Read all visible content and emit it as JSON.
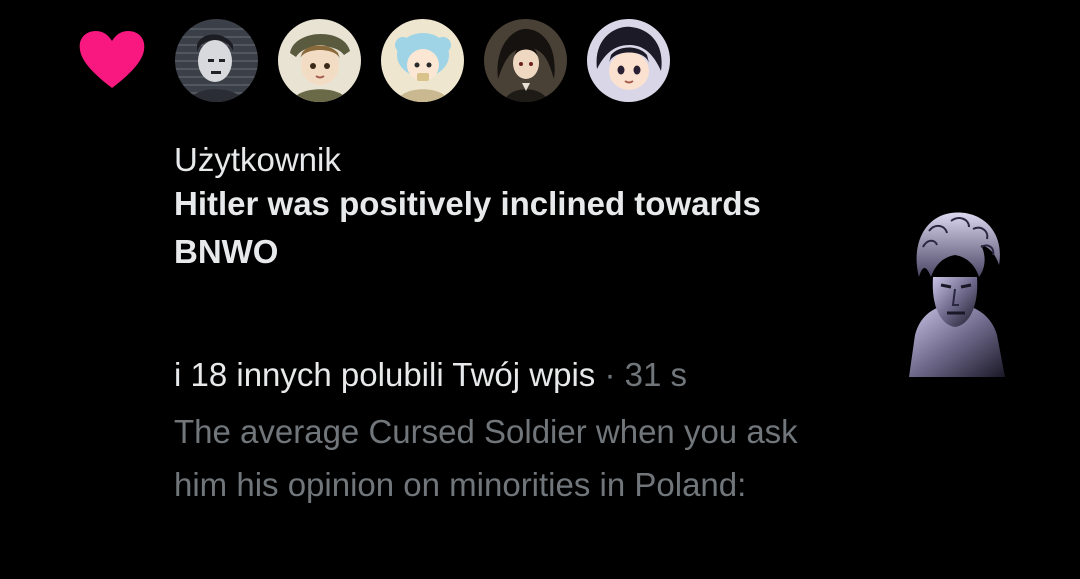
{
  "notification": {
    "icon": "heart-icon",
    "accent_color": "#f91880",
    "avatars": [
      {
        "icon": "avatar-1"
      },
      {
        "icon": "avatar-2"
      },
      {
        "icon": "avatar-3"
      },
      {
        "icon": "avatar-4"
      },
      {
        "icon": "avatar-5"
      }
    ],
    "first_user": {
      "name": "Użytkownik",
      "post_title": "Hitler was positively inclined towards BNWO"
    },
    "like_summary": {
      "text": "i 18 innych polubili Twój wpis",
      "separator": "·",
      "time": "31 s"
    },
    "tweet_text": "The average Cursed Soldier when you ask him his opinion on minorities in Poland:",
    "side_image": "statue-bust-image"
  },
  "colors": {
    "background": "#000000",
    "primary_text": "#e7e9ea",
    "secondary_text": "#71767b"
  }
}
